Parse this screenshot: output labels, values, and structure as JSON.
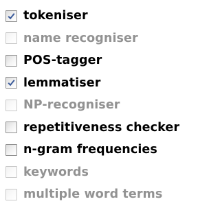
{
  "options": [
    {
      "label": "tokeniser",
      "checked": true,
      "enabled": true
    },
    {
      "label": "name recogniser",
      "checked": false,
      "enabled": false
    },
    {
      "label": "POS-tagger",
      "checked": false,
      "enabled": true
    },
    {
      "label": "lemmatiser",
      "checked": true,
      "enabled": true
    },
    {
      "label": "NP-recogniser",
      "checked": false,
      "enabled": false
    },
    {
      "label": "repetitiveness checker",
      "checked": false,
      "enabled": true
    },
    {
      "label": "n-gram frequencies",
      "checked": false,
      "enabled": true
    },
    {
      "label": "keywords",
      "checked": false,
      "enabled": false
    },
    {
      "label": "multiple word terms",
      "checked": false,
      "enabled": false
    }
  ],
  "colors": {
    "enabled_text": "#000000",
    "disabled_text": "#929292",
    "check_mark": "#3a5a9a"
  },
  "icons": {
    "check": "check-icon"
  }
}
